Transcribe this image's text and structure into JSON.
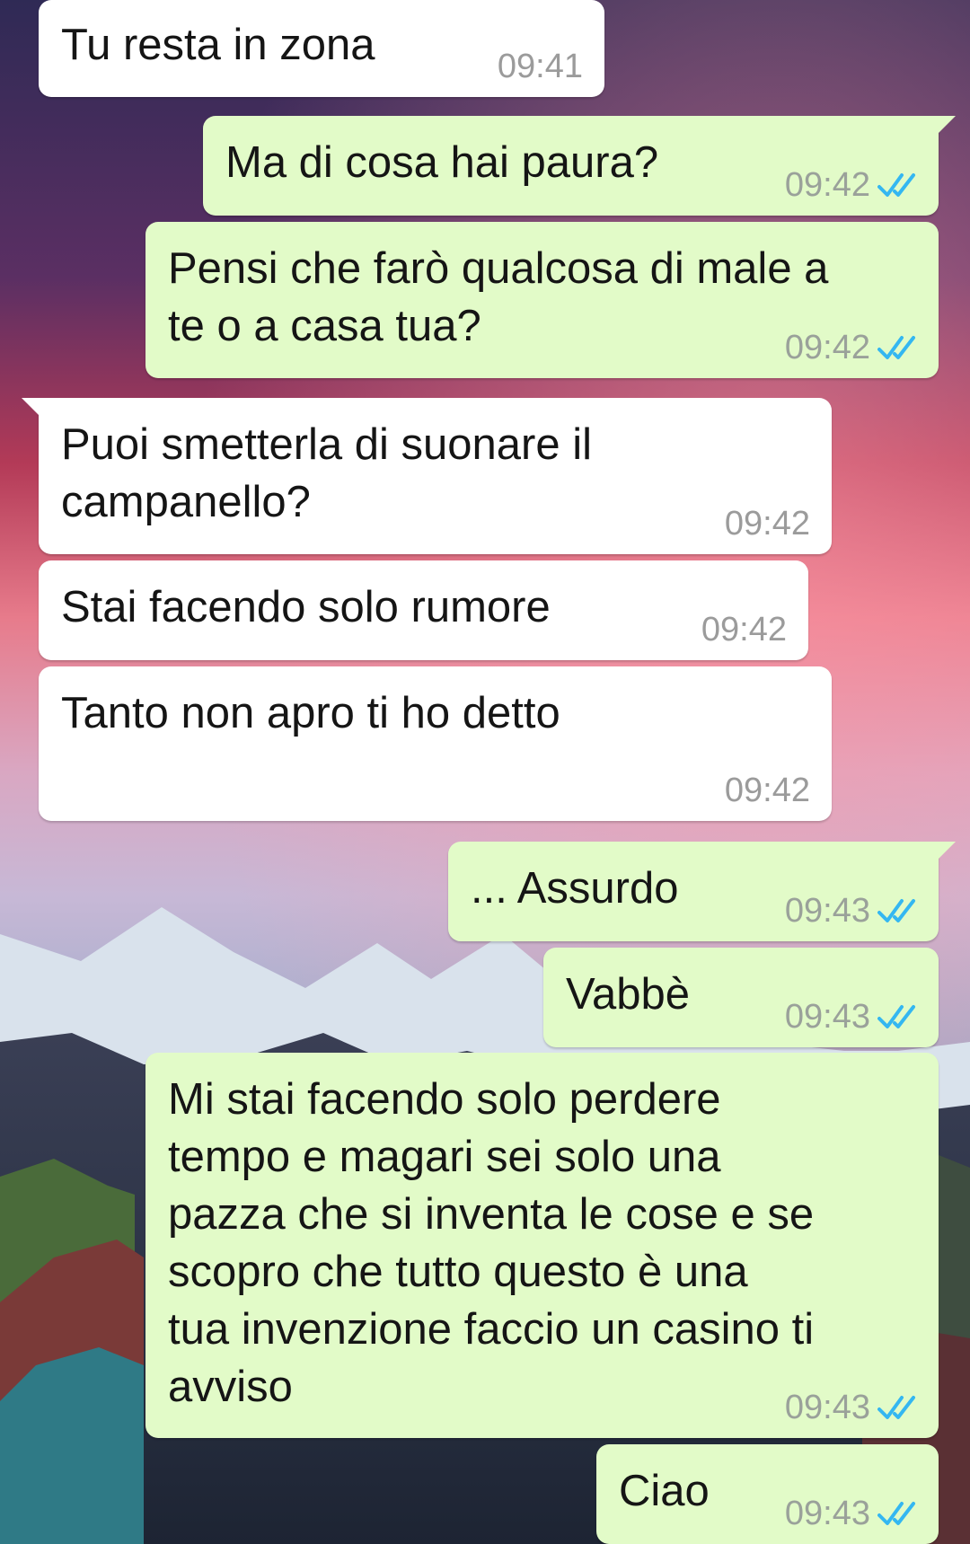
{
  "messages": [
    {
      "direction": "in",
      "lines": [
        "Tu resta in zona"
      ],
      "time": "09:41"
    },
    {
      "direction": "out",
      "lines": [
        "Ma di cosa hai paura?"
      ],
      "time": "09:42",
      "status": "read"
    },
    {
      "direction": "out",
      "lines": [
        "Pensi che farò qualcosa di male a",
        "te o a casa tua?"
      ],
      "time": "09:42",
      "status": "read"
    },
    {
      "direction": "in",
      "lines": [
        "Puoi smetterla di suonare il",
        "campanello?"
      ],
      "time": "09:42"
    },
    {
      "direction": "in",
      "lines": [
        "Stai facendo solo rumore"
      ],
      "time": "09:42"
    },
    {
      "direction": "in",
      "lines": [
        "Tanto non apro ti ho detto"
      ],
      "time": "09:42"
    },
    {
      "direction": "out",
      "lines": [
        "... Assurdo"
      ],
      "time": "09:43",
      "status": "read"
    },
    {
      "direction": "out",
      "lines": [
        "Vabbè"
      ],
      "time": "09:43",
      "status": "read"
    },
    {
      "direction": "out",
      "lines": [
        "Mi stai facendo solo perdere",
        "tempo e magari sei solo una",
        "pazza che si inventa le cose e se",
        "scopro che tutto questo è una",
        "tua invenzione faccio un casino ti",
        "avviso"
      ],
      "time": "09:43",
      "status": "read"
    },
    {
      "direction": "out",
      "lines": [
        "Ciao"
      ],
      "time": "09:43",
      "status": "read"
    }
  ],
  "icons": {
    "read_receipt": "double-check-icon"
  },
  "colors": {
    "incoming_bubble": "#ffffff",
    "outgoing_bubble": "#e2fbc8",
    "read_tick": "#34b7f1",
    "timestamp": "#9b9b9b"
  }
}
